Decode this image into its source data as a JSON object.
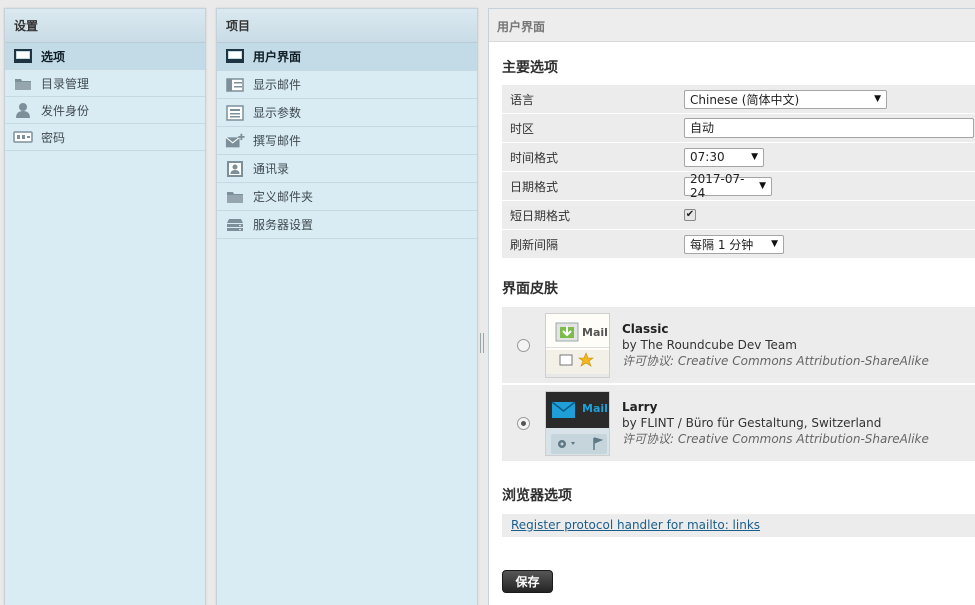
{
  "settings_nav": {
    "title": "设置",
    "items": [
      {
        "label": "选项",
        "icon": "monitor-icon",
        "selected": true
      },
      {
        "label": "目录管理",
        "icon": "folder-icon",
        "selected": false
      },
      {
        "label": "发件身份",
        "icon": "person-icon",
        "selected": false
      },
      {
        "label": "密码",
        "icon": "password-icon",
        "selected": false
      }
    ]
  },
  "sections_nav": {
    "title": "项目",
    "items": [
      {
        "label": "用户界面",
        "icon": "monitor-icon",
        "selected": true
      },
      {
        "label": "显示邮件",
        "icon": "mailbox-view-icon",
        "selected": false
      },
      {
        "label": "显示参数",
        "icon": "display-message-icon",
        "selected": false
      },
      {
        "label": "撰写邮件",
        "icon": "compose-icon",
        "selected": false
      },
      {
        "label": "通讯录",
        "icon": "addressbook-icon",
        "selected": false
      },
      {
        "label": "定义邮件夹",
        "icon": "folder-icon",
        "selected": false
      },
      {
        "label": "服务器设置",
        "icon": "server-icon",
        "selected": false
      }
    ]
  },
  "prefs": {
    "header": "用户界面",
    "main_title": "主要选项",
    "rows": {
      "language": {
        "label": "语言",
        "value": "Chinese (简体中文)"
      },
      "timezone": {
        "label": "时区",
        "value": "自动"
      },
      "time_format": {
        "label": "时间格式",
        "value": "07:30"
      },
      "date_format": {
        "label": "日期格式",
        "value": "2017-07-24"
      },
      "pretty_date": {
        "label": "短日期格式",
        "checked": true
      },
      "refresh": {
        "label": "刷新间隔",
        "value": "每隔 1 分钟"
      }
    },
    "skin_title": "界面皮肤",
    "skins": [
      {
        "name": "Classic",
        "author": "by The Roundcube Dev Team",
        "license": "许可协议: Creative Commons Attribution-ShareAlike",
        "selected": false,
        "thumb_text": "Mail"
      },
      {
        "name": "Larry",
        "author": "by FLINT / Büro für Gestaltung, Switzerland",
        "license": "许可协议: Creative Commons Attribution-ShareAlike",
        "selected": true,
        "thumb_text": "Mail"
      }
    ],
    "browser_title": "浏览器选项",
    "protocol_link": "Register protocol handler for mailto: links",
    "save_label": "保存"
  },
  "colors": {
    "panel_bg": "#d9ecf4",
    "selected_bg": "#c3dbe6",
    "link": "#1b5e8a",
    "save_button": "#2c2c2c",
    "larry_accent": "#1e9fd7"
  }
}
